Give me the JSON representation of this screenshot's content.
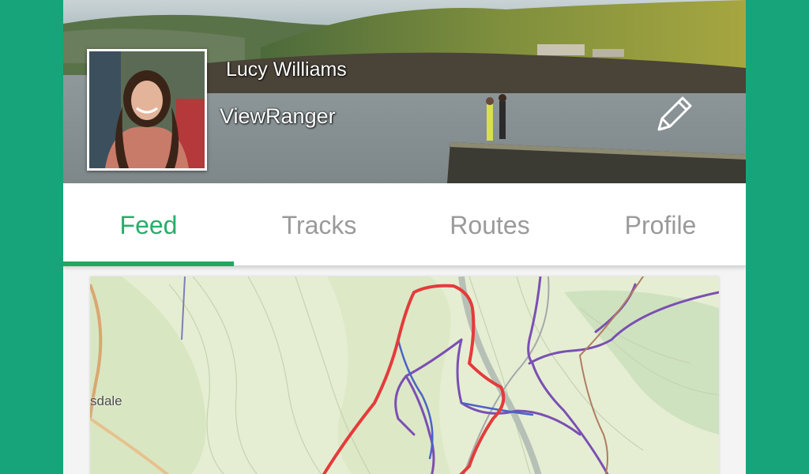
{
  "profile": {
    "name": "Lucy Williams",
    "organization": "ViewRanger"
  },
  "tabs": [
    {
      "label": "Feed",
      "active": true
    },
    {
      "label": "Tracks",
      "active": false
    },
    {
      "label": "Routes",
      "active": false
    },
    {
      "label": "Profile",
      "active": false
    }
  ],
  "map": {
    "place_label": "sdale"
  },
  "icons": {
    "edit": "pencil-icon"
  },
  "colors": {
    "frame": "#18a47a",
    "tab_active": "#27ae6a",
    "tab_inactive": "#9a9a9a",
    "route_red": "#e43b3b",
    "route_purple": "#7b4fb3"
  }
}
